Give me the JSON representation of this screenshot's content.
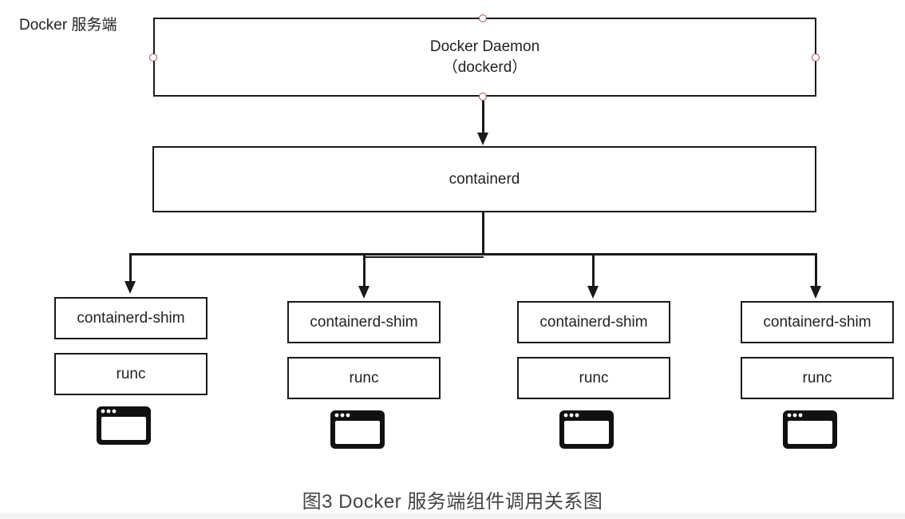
{
  "region_label": "Docker 服务端",
  "daemon": {
    "line1": "Docker Daemon",
    "line2": "（dockerd）"
  },
  "containerd": {
    "label": "containerd"
  },
  "columns": [
    {
      "shim_label": "containerd-shim",
      "runc_label": "runc",
      "icon": "browser-window-icon"
    },
    {
      "shim_label": "containerd-shim",
      "runc_label": "runc",
      "icon": "browser-window-icon"
    },
    {
      "shim_label": "containerd-shim",
      "runc_label": "runc",
      "icon": "browser-window-icon"
    },
    {
      "shim_label": "containerd-shim",
      "runc_label": "runc",
      "icon": "browser-window-icon"
    }
  ],
  "caption": "图3 Docker 服务端组件调用关系图",
  "colors": {
    "stroke": "#1a1a1a",
    "handle": "#a05050",
    "caption": "#444444"
  }
}
